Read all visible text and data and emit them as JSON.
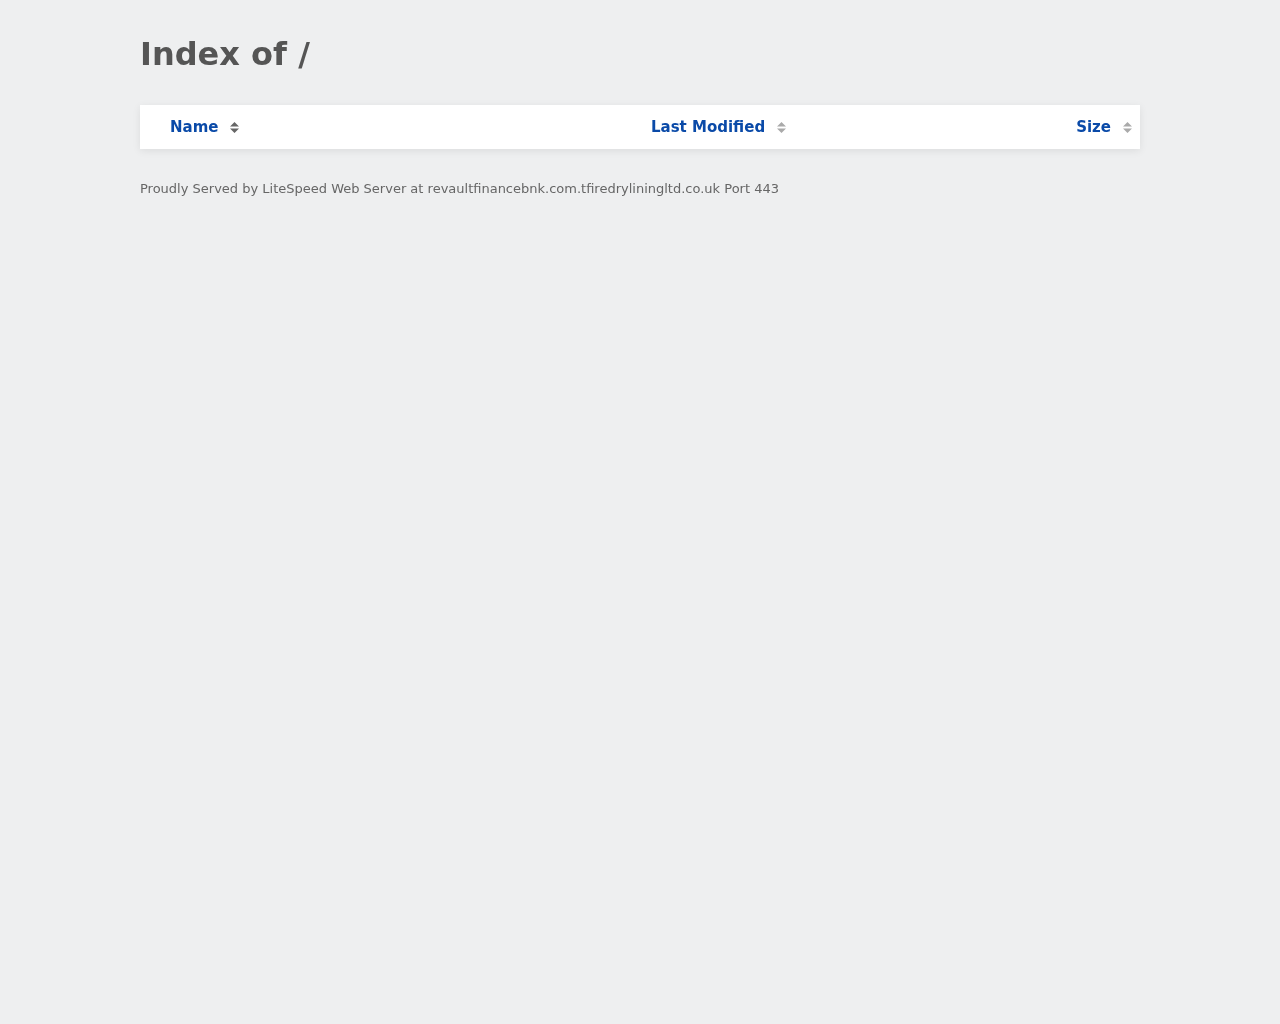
{
  "title": "Index of /",
  "table": {
    "columns": [
      {
        "label": "Name",
        "selected": true
      },
      {
        "label": "Last Modified",
        "selected": false
      },
      {
        "label": "Size",
        "selected": false
      }
    ]
  },
  "footer": "Proudly Served by LiteSpeed Web Server at revaultfinancebnk.com.tfiredryliningltd.co.uk Port 443"
}
